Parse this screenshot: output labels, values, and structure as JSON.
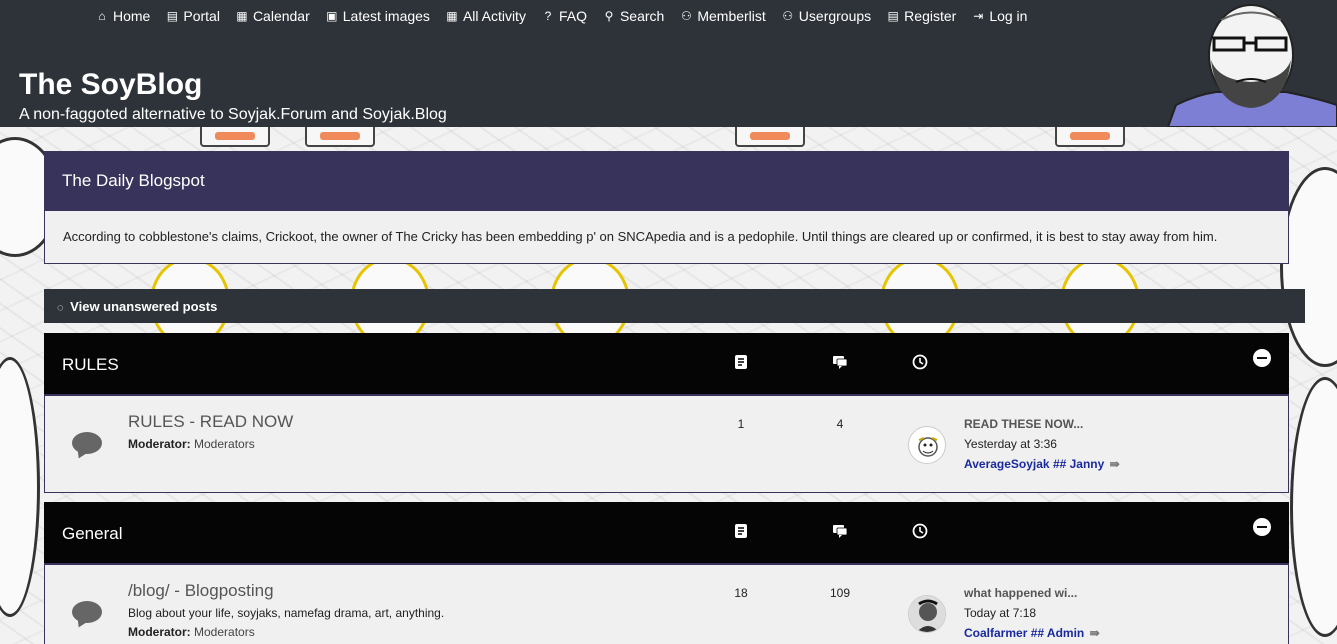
{
  "nav": [
    {
      "label": "Home",
      "icon": "home-icon"
    },
    {
      "label": "Portal",
      "icon": "portal-icon"
    },
    {
      "label": "Calendar",
      "icon": "calendar-icon"
    },
    {
      "label": "Latest images",
      "icon": "image-icon"
    },
    {
      "label": "All Activity",
      "icon": "activity-icon"
    },
    {
      "label": "FAQ",
      "icon": "question-icon"
    },
    {
      "label": "Search",
      "icon": "search-icon"
    },
    {
      "label": "Memberlist",
      "icon": "members-icon"
    },
    {
      "label": "Usergroups",
      "icon": "usergroups-icon"
    },
    {
      "label": "Register",
      "icon": "register-icon"
    },
    {
      "label": "Log in",
      "icon": "login-icon"
    }
  ],
  "site": {
    "title": "The SoyBlog",
    "description": "A non-faggoted alternative to Soyjak.Forum and Soyjak.Blog"
  },
  "daily": {
    "title": "The Daily Blogspot",
    "body": "According to cobblestone's claims, Crickoot, the owner of The Cricky has been embedding p' on SNCApedia and is a pedophile. Until things are cleared up or confirmed, it is best to stay away from him."
  },
  "unanswered": {
    "label": "View unanswered posts",
    "icon": "chat-bubble-icon"
  },
  "categories": [
    {
      "title": "RULES",
      "forums": [
        {
          "name": "RULES - READ NOW",
          "description": "",
          "moderator_label": "Moderator:",
          "moderator": "Moderators",
          "topics": "1",
          "posts": "4",
          "last_title": "READ THESE NOW...",
          "last_time": "Yesterday at 3:36",
          "last_user": "AverageSoyjak ## Janny",
          "last_arrow": "⇛"
        }
      ]
    },
    {
      "title": "General",
      "forums": [
        {
          "name": "/blog/ - Blogposting",
          "description": "Blog about your life, soyjaks, namefag drama, art, anything.",
          "moderator_label": "Moderator:",
          "moderator": "Moderators",
          "topics": "18",
          "posts": "109",
          "last_title": "what happened wi...",
          "last_time": "Today at 7:18",
          "last_user": "Coalfarmer ## Admin",
          "last_arrow": "⇛"
        }
      ]
    }
  ],
  "colors": {
    "header_bg": "#2e3339",
    "daily_head_bg": "#38335a",
    "category_bg": "#050505",
    "user_link": "#1a2a9e"
  }
}
